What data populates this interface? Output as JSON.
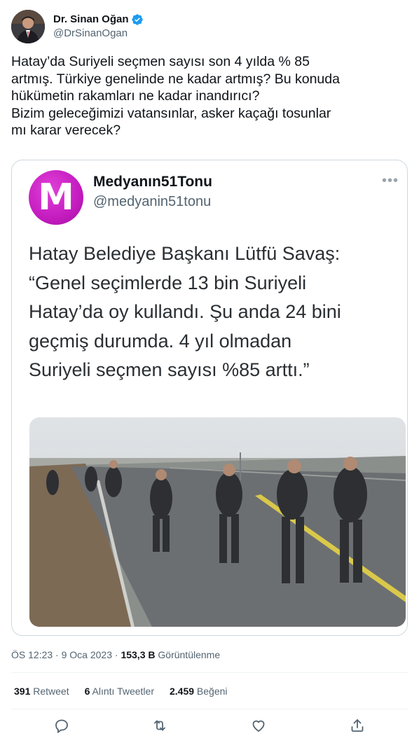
{
  "author": {
    "display_name": "Dr. Sinan Oğan",
    "handle": "@DrSinanOgan",
    "verified": true
  },
  "tweet": {
    "text": "Hatay’da Suriyeli seçmen sayısı son 4 yılda % 85\nartmış. Türkiye genelinde ne kadar artmış? Bu konuda\nhükümetin rakamları ne kadar inandırıcı?\nBizim geleceğimizi vatansınlar, asker kaçağı tosunlar\nmı karar verecek?"
  },
  "quoted": {
    "display_name": "Medyanın51Tonu",
    "handle": "@medyanin51tonu",
    "avatar_letter": "M",
    "more_icon": "ellipsis-icon",
    "text": "Hatay Belediye Başkanı Lütfü Savaş:\n“Genel seçimlerde 13 bin Suriyeli\nHatay’da oy kullandı. Şu anda 24 bini\ngeçmiş durumda. 4 yıl olmadan\nSuriyeli seçmen sayısı %85 arttı.”"
  },
  "meta": {
    "time": "ÖS 12:23",
    "date": "9 Oca 2023",
    "views_count": "153,3 B",
    "views_label": "Görüntülenme"
  },
  "stats": {
    "retweets_count": "391",
    "retweets_label": "Retweet",
    "quotes_count": "6",
    "quotes_label": "Alıntı Tweetler",
    "likes_count": "2.459",
    "likes_label": "Beğeni"
  },
  "actions": [
    "reply-icon",
    "retweet-icon",
    "like-icon",
    "share-icon"
  ],
  "colors": {
    "text": "#0f1419",
    "secondary": "#536471",
    "verified": "#1d9bf0",
    "border": "#cfd9de",
    "brand_magenta": "#c41cbf"
  }
}
